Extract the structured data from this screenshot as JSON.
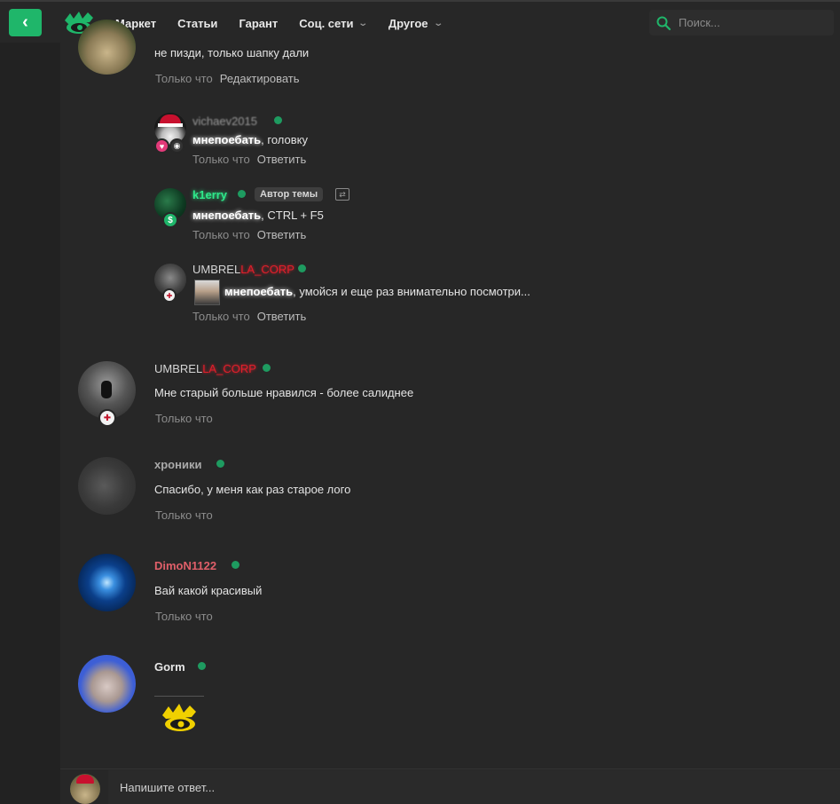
{
  "nav": {
    "items": [
      {
        "label": "Маркет"
      },
      {
        "label": "Статьи"
      },
      {
        "label": "Гарант"
      },
      {
        "label": "Соц. сети"
      },
      {
        "label": "Другое"
      }
    ],
    "search_placeholder": "Поиск..."
  },
  "colors": {
    "accent": "#1fb66a",
    "online": "#1e9b60",
    "username_red": "#e05f69",
    "username_green": "#2ee88a"
  },
  "comments": {
    "c0": {
      "text": "не пизди, только шапку дали",
      "time": "Только что",
      "action": "Редактировать"
    },
    "r1": {
      "username": "vichaev2015",
      "mention": "мнепоебать",
      "text": ", головку",
      "time": "Только что",
      "action": "Ответить"
    },
    "r2": {
      "username": "k1erry",
      "author_tag": "Автор темы",
      "mention": "мнепоебать",
      "text": ", CTRL + F5",
      "time": "Только что",
      "action": "Ответить"
    },
    "r3": {
      "username_a": "UMBREL",
      "username_b": "LA_CORP",
      "mention": "мнепоебать",
      "text": ", умойся и еще раз внимательно посмотри...",
      "time": "Только что",
      "action": "Ответить"
    },
    "c4": {
      "username_a": "UMBREL",
      "username_b": "LA_CORP",
      "text": "Мне старый больше нравился - более салиднее",
      "time": "Только что"
    },
    "c5": {
      "username": "хроники",
      "text": "Спасибо, у меня как раз старое лого",
      "time": "Только что"
    },
    "c6": {
      "username": "DimoN1122",
      "text": "Вай какой красивый",
      "time": "Только что"
    },
    "c7": {
      "username": "Gorm"
    }
  },
  "reply": {
    "placeholder": "Напишите ответ..."
  }
}
